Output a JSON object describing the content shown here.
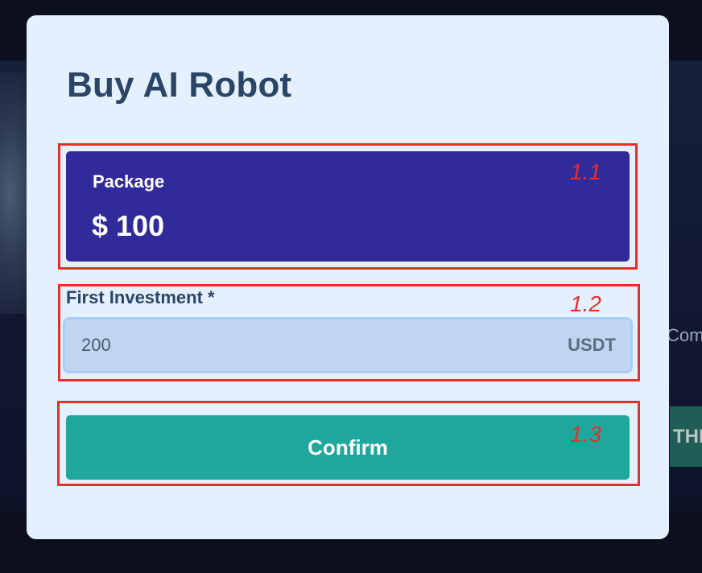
{
  "background": {
    "right_text": "Com",
    "right_button_text": "THI"
  },
  "modal": {
    "title": "Buy AI Robot",
    "package": {
      "label": "Package",
      "value": "$ 100"
    },
    "investment": {
      "label": "First Investment *",
      "value": "200",
      "suffix": "USDT"
    },
    "confirm_label": "Confirm"
  },
  "annotations": {
    "box1": "1.1",
    "box2": "1.2",
    "box3": "1.3",
    "color": "#e4302a"
  },
  "colors": {
    "modal_bg": "#e5f0fe",
    "title": "#2a4566",
    "package_bg": "#312a9a",
    "confirm_bg": "#1fa79e",
    "input_bg": "#c0d6f0"
  }
}
